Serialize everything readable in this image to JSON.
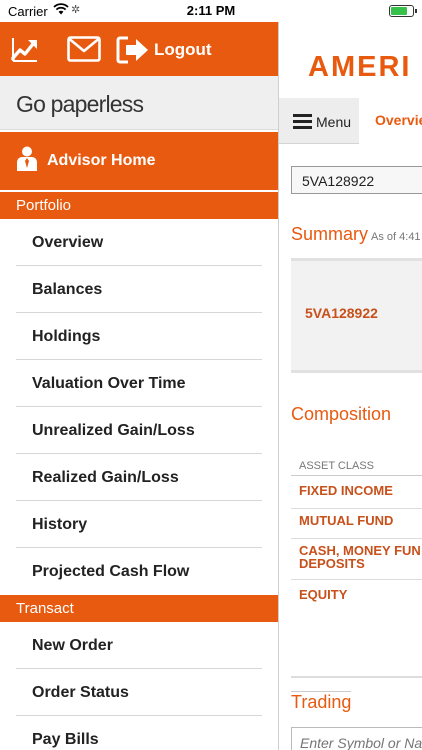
{
  "status_bar": {
    "carrier": "Carrier",
    "time": "2:11 PM"
  },
  "sidebar": {
    "logout_label": "Logout",
    "paperless_label": "Go paperless",
    "advisor_home_label": "Advisor Home",
    "sections": [
      {
        "title": "Portfolio",
        "items": [
          "Overview",
          "Balances",
          "Holdings",
          "Valuation Over Time",
          "Unrealized Gain/Loss",
          "Realized Gain/Loss",
          "History",
          "Projected Cash Flow"
        ]
      },
      {
        "title": "Transact",
        "items": [
          "New Order",
          "Order Status",
          "Pay Bills"
        ]
      }
    ]
  },
  "main": {
    "logo_text": "AMERI",
    "tabs": {
      "menu_label": "Menu",
      "overview_label": "Overvie"
    },
    "account_value": "5VA128922",
    "summary": {
      "title": "Summary",
      "as_of": "As of 4:41",
      "account": "5VA128922"
    },
    "composition": {
      "title": "Composition",
      "header": "ASSET CLASS",
      "rows": [
        "FIXED INCOME",
        "MUTUAL FUND",
        "CASH, MONEY FUN\nDEPOSITS",
        "EQUITY"
      ]
    },
    "trading": {
      "title": "Trading",
      "symbol_placeholder": "Enter Symbol or Na"
    }
  },
  "colors": {
    "brand_orange": "#e85a0f",
    "text_orange": "#c8501b"
  }
}
